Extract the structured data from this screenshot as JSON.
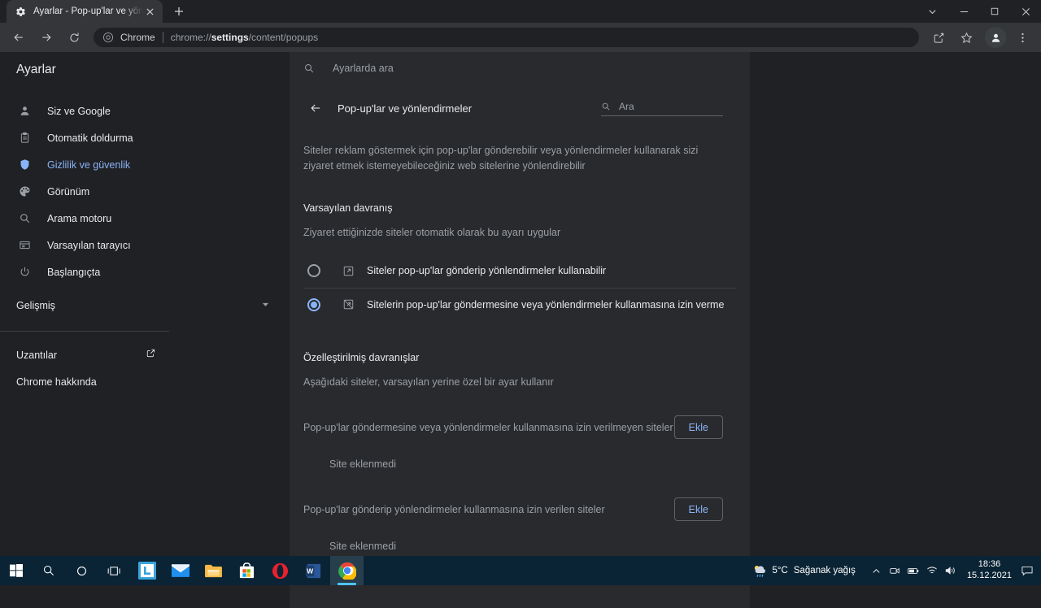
{
  "window": {
    "tab": {
      "favicon": "gear-icon",
      "title": "Ayarlar - Pop-up'lar ve yönlendirmeler",
      "close_label": "✕"
    },
    "newtab_label": "+",
    "controls": {
      "tabsearch": "tab-search-icon",
      "minimize": "minimize-icon",
      "maximize": "maximize-icon",
      "close": "close-icon"
    }
  },
  "toolbar": {
    "back": "back-icon",
    "forward": "forward-icon",
    "reload": "reload-icon",
    "omnibox": {
      "scheme_label": "Chrome",
      "url_prefix": "chrome://",
      "url_bold": "settings",
      "url_suffix": "/content/popups"
    },
    "share": "share-icon",
    "bookmark": "star-icon",
    "profile": "avatar-icon",
    "menu": "three-dot-menu-icon"
  },
  "sidebar": {
    "title": "Ayarlar",
    "items": [
      {
        "label": "Siz ve Google",
        "icon": "person-icon",
        "active": false
      },
      {
        "label": "Otomatik doldurma",
        "icon": "clipboard-icon",
        "active": false
      },
      {
        "label": "Gizlilik ve güvenlik",
        "icon": "shield-icon",
        "active": true
      },
      {
        "label": "Görünüm",
        "icon": "palette-icon",
        "active": false
      },
      {
        "label": "Arama motoru",
        "icon": "search-icon",
        "active": false
      },
      {
        "label": "Varsayılan tarayıcı",
        "icon": "browser-window-icon",
        "active": false
      },
      {
        "label": "Başlangıçta",
        "icon": "power-icon",
        "active": false
      }
    ],
    "advanced": {
      "label": "Gelişmiş",
      "icon": "chevron-down-icon"
    },
    "bottom": [
      {
        "label": "Uzantılar",
        "icon": "external-link-icon"
      },
      {
        "label": "Chrome hakkında",
        "icon": ""
      }
    ]
  },
  "search_top": {
    "icon": "search-icon",
    "placeholder": "Ayarlarda ara"
  },
  "section": {
    "back_icon": "arrow-left-icon",
    "title": "Pop-up'lar ve yönlendirmeler",
    "search": {
      "icon": "search-icon",
      "placeholder": "Ara"
    },
    "description": "Siteler reklam göstermek için pop-up'lar gönderebilir veya yönlendirmeler kullanarak sizi ziyaret etmek istemeyebileceğiniz web sitelerine yönlendirebilir",
    "default_behavior": {
      "title": "Varsayılan davranış",
      "subtitle": "Ziyaret ettiğinizde siteler otomatik olarak bu ayarı uygular",
      "options": [
        {
          "label": "Siteler pop-up'lar gönderip yönlendirmeler kullanabilir",
          "icon": "open-in-new-icon",
          "selected": false
        },
        {
          "label": "Sitelerin pop-up'lar göndermesine veya yönlendirmeler kullanmasına izin verme",
          "icon": "open-in-new-off-icon",
          "selected": true
        }
      ]
    },
    "custom_behaviors": {
      "title": "Özelleştirilmiş davranışlar",
      "subtitle": "Aşağıdaki siteler, varsayılan yerine özel bir ayar kullanır",
      "blocked": {
        "label": "Pop-up'lar göndermesine veya yönlendirmeler kullanmasına izin verilmeyen siteler",
        "add_label": "Ekle",
        "empty": "Site eklenmedi"
      },
      "allowed": {
        "label": "Pop-up'lar gönderip yönlendirmeler kullanmasına izin verilen siteler",
        "add_label": "Ekle",
        "empty": "Site eklenmedi"
      }
    }
  },
  "taskbar": {
    "start": "windows-start-icon",
    "search": "search-icon",
    "cortana": "cortana-icon",
    "taskview": "task-view-icon",
    "apps": [
      {
        "name": "lightshot-icon",
        "label": "L"
      },
      {
        "name": "mail-icon",
        "label": ""
      },
      {
        "name": "file-explorer-icon",
        "label": ""
      },
      {
        "name": "microsoft-store-icon",
        "label": ""
      },
      {
        "name": "opera-icon",
        "label": "O"
      },
      {
        "name": "word-icon",
        "label": "W"
      },
      {
        "name": "chrome-icon",
        "label": ""
      }
    ],
    "weather": {
      "icon": "rain-cloud-icon",
      "temperature": "5°C",
      "condition": "Sağanak yağış"
    },
    "tray": [
      "chevron-up-icon",
      "camera-icon",
      "battery-icon",
      "wifi-icon",
      "volume-icon"
    ],
    "clock": {
      "time": "18:36",
      "date": "15.12.2021"
    },
    "action_center": "notification-icon"
  },
  "colors": {
    "accent": "#8ab4f8",
    "page_bg": "#202124",
    "card_bg": "#292a2d",
    "toolbar_bg": "#35363a",
    "taskbar_bg": "#0a2435"
  }
}
